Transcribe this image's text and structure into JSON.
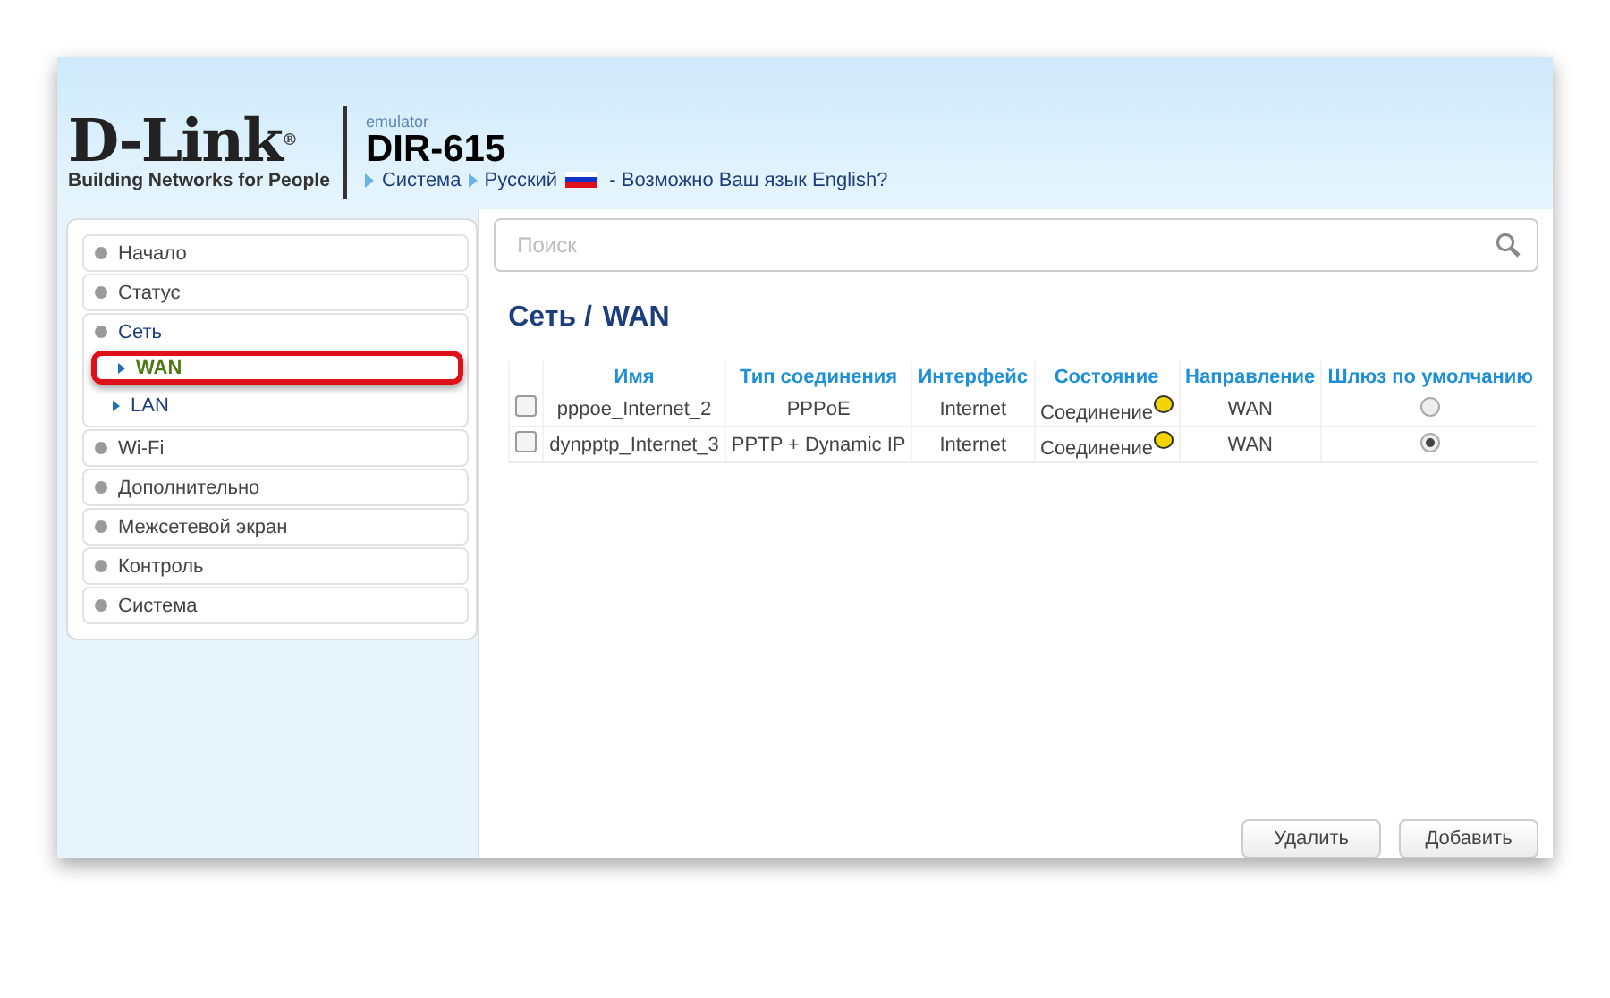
{
  "header": {
    "logo": {
      "name": "D-Link",
      "mark": "®",
      "tagline": "Building Networks for People"
    },
    "subtitle": "emulator",
    "model": "DIR-615",
    "breadcrumbs": [
      {
        "label": "Система"
      },
      {
        "label": "Русский"
      }
    ],
    "language_prompt": "- Возможно Ваш язык English?"
  },
  "sidebar": {
    "items": [
      {
        "label": "Начало",
        "expanded": false
      },
      {
        "label": "Статус",
        "expanded": false
      },
      {
        "label": "Сеть",
        "expanded": true,
        "children": [
          {
            "label": "WAN",
            "selected": true
          },
          {
            "label": "LAN",
            "selected": false
          }
        ]
      },
      {
        "label": "Wi-Fi",
        "expanded": false
      },
      {
        "label": "Дополнительно",
        "expanded": false
      },
      {
        "label": "Межсетевой экран",
        "expanded": false
      },
      {
        "label": "Контроль",
        "expanded": false
      },
      {
        "label": "Система",
        "expanded": false
      }
    ]
  },
  "search": {
    "placeholder": "Поиск"
  },
  "page_title": {
    "section": "Сеть /",
    "page": "WAN"
  },
  "table": {
    "columns": [
      "Имя",
      "Тип соединения",
      "Интерфейс",
      "Состояние",
      "Направление",
      "Шлюз по умолчанию"
    ],
    "rows": [
      {
        "checked": false,
        "name": "pppoe_Internet_2",
        "type": "PPPoE",
        "interface": "Internet",
        "status": "Соединение",
        "color": "#f2d500",
        "direction": "WAN",
        "default_gateway": false
      },
      {
        "checked": false,
        "name": "dynpptp_Internet_3",
        "type": "PPTP + Dynamic IP",
        "interface": "Internet",
        "status": "Соединение",
        "color": "#f2d500",
        "direction": "WAN",
        "default_gateway": true
      }
    ]
  },
  "buttons": [
    {
      "label": "Удалить"
    },
    {
      "label": "Добавить"
    }
  ]
}
